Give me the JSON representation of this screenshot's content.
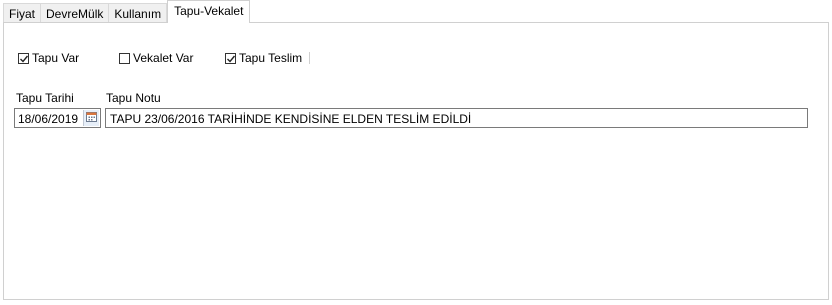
{
  "tabs": [
    {
      "label": "Fiyat",
      "active": false
    },
    {
      "label": "DevreMülk",
      "active": false
    },
    {
      "label": "Kullanım",
      "active": false
    },
    {
      "label": "Tapu-Vekalet",
      "active": true
    }
  ],
  "checkboxes": {
    "tapu_var": {
      "label": "Tapu Var",
      "checked": true
    },
    "vekalet_var": {
      "label": "Vekalet Var",
      "checked": false
    },
    "tapu_teslim": {
      "label": "Tapu Teslim",
      "checked": true
    }
  },
  "fields": {
    "tapu_tarihi": {
      "label": "Tapu Tarihi",
      "value": "18/06/2019"
    },
    "tapu_notu": {
      "label": "Tapu Notu",
      "value": "TAPU 23/06/2016 TARİHİNDE KENDİSİNE ELDEN TESLİM EDİLDİ"
    }
  },
  "icons": {
    "calendar": "calendar-icon",
    "check": "checkmark-icon"
  },
  "colors": {
    "border": "#7a7a7a",
    "tab_bg": "#f0f0f0",
    "panel_border": "#d0d0d0"
  }
}
